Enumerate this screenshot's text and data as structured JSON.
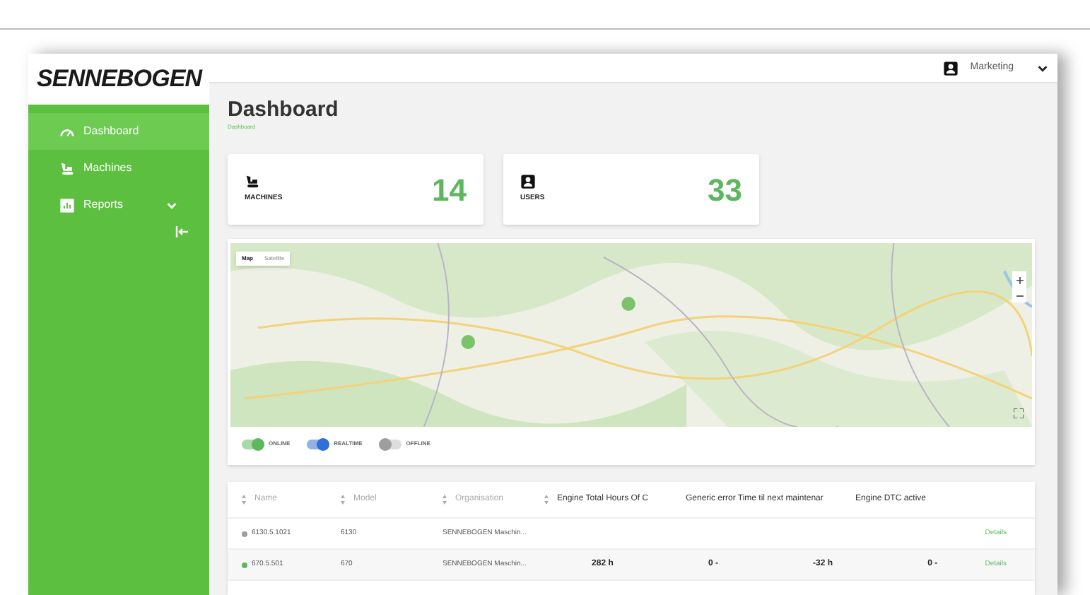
{
  "logo": {
    "text": "SENNEBOGEN"
  },
  "sidebar": {
    "items": [
      {
        "label": "Dashboard",
        "selected": true,
        "expandable": false
      },
      {
        "label": "Machines",
        "selected": false,
        "expandable": false
      },
      {
        "label": "Reports",
        "selected": false,
        "expandable": true
      }
    ]
  },
  "header": {
    "user": "Marketing"
  },
  "page": {
    "title": "Dashboard",
    "breadcrumb": "Dashboard"
  },
  "stats": [
    {
      "label": "MACHINES",
      "value": "14"
    },
    {
      "label": "USERS",
      "value": "33"
    }
  ],
  "map": {
    "types": [
      {
        "label": "Map",
        "selected": true
      },
      {
        "label": "Satellite",
        "selected": false
      }
    ],
    "legend": [
      {
        "label": "ONLINE",
        "on": true,
        "color": "#5cb85c"
      },
      {
        "label": "REALTIME",
        "on": true,
        "color": "#2f6fd6"
      },
      {
        "label": "OFFLINE",
        "on": false,
        "color": "#9e9e9e"
      }
    ]
  },
  "table": {
    "columns": [
      {
        "label": "Name",
        "sortable": true
      },
      {
        "label": "Model",
        "sortable": true
      },
      {
        "label": "Organisation",
        "sortable": true
      },
      {
        "label": "Engine Total Hours Of C",
        "sortable": true
      },
      {
        "label": "Generic error Time til next maintenar",
        "sortable": false
      },
      {
        "label": "Engine DTC active",
        "sortable": false
      }
    ],
    "rows": [
      {
        "color": "#9e9e9e",
        "cells": [
          "6130.5.1021",
          "6130",
          "SENNEBOGEN Maschin..."
        ],
        "values": [],
        "action": "Details"
      },
      {
        "color": "#5cb85c",
        "cells": [
          "670.5.501",
          "670",
          "SENNEBOGEN Maschin..."
        ],
        "values": [
          "282 h",
          "0 -",
          "-32 h",
          "0 -"
        ],
        "action": "Details"
      }
    ]
  }
}
